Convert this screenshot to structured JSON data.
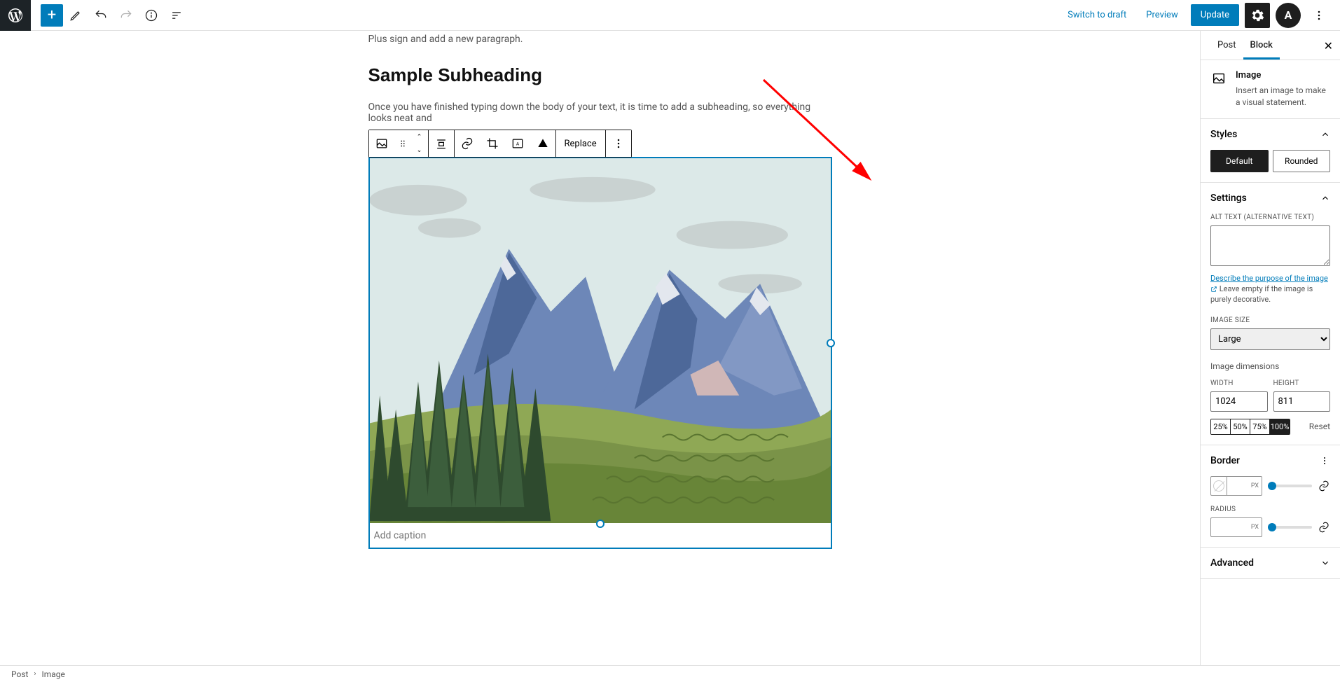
{
  "topbar": {
    "switch_draft": "Switch to draft",
    "preview": "Preview",
    "update": "Update",
    "astra_letter": "A"
  },
  "editor": {
    "para1": "Plus sign and add a new paragraph.",
    "subheading": "Sample Subheading",
    "para2": "Once you have finished typing down the body of your text, it is time to add a subheading, so everything looks neat and",
    "replace": "Replace",
    "caption_placeholder": "Add caption"
  },
  "sidebar": {
    "tab_post": "Post",
    "tab_block": "Block",
    "block_name": "Image",
    "block_desc": "Insert an image to make a visual statement.",
    "styles_title": "Styles",
    "style_default": "Default",
    "style_rounded": "Rounded",
    "settings_title": "Settings",
    "alt_label": "ALT TEXT (ALTERNATIVE TEXT)",
    "alt_help_link": "Describe the purpose of the image",
    "alt_help_rest": "Leave empty if the image is purely decorative.",
    "image_size_label": "IMAGE SIZE",
    "image_size_value": "Large",
    "dimensions_label": "Image dimensions",
    "width_label": "WIDTH",
    "width_value": "1024",
    "height_label": "HEIGHT",
    "height_value": "811",
    "pct25": "25%",
    "pct50": "50%",
    "pct75": "75%",
    "pct100": "100%",
    "reset": "Reset",
    "border_title": "Border",
    "px": "PX",
    "radius_label": "RADIUS",
    "advanced_title": "Advanced"
  },
  "footer": {
    "post": "Post",
    "image": "Image"
  }
}
